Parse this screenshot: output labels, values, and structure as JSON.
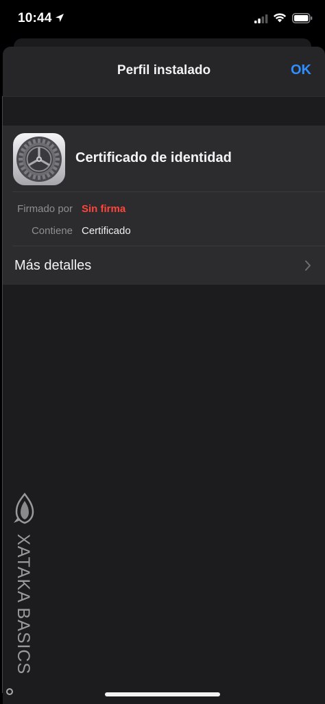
{
  "status_bar": {
    "time": "10:44",
    "icons": [
      "location-arrow-icon",
      "cellular-signal-icon",
      "wifi-icon",
      "battery-icon"
    ]
  },
  "nav": {
    "title": "Perfil instalado",
    "ok_label": "OK"
  },
  "profile": {
    "icon": "settings-gear-icon",
    "name": "Certificado de identidad",
    "rows": [
      {
        "label": "Firmado por",
        "value": "Sin firma",
        "value_color": "#ff453a"
      },
      {
        "label": "Contiene",
        "value": "Certificado",
        "value_color": "#f0f0f0"
      }
    ],
    "details_label": "Más detalles"
  },
  "watermark": {
    "text": "XATAKA BASICS"
  },
  "colors": {
    "accent": "#2f8fff",
    "danger": "#ff453a",
    "sheet_bg": "#1c1c1e",
    "group_bg": "#2c2c2e"
  }
}
